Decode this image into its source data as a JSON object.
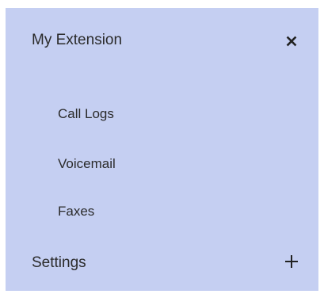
{
  "menu": {
    "sections": [
      {
        "label": "My Extension",
        "toggle_icon": "close-icon",
        "items": [
          "Call Logs",
          "Voicemail",
          "Faxes"
        ]
      },
      {
        "label": "Settings",
        "toggle_icon": "plus-icon",
        "items": []
      }
    ]
  },
  "colors": {
    "panel_background": "#c5cff2",
    "text": "#2b2b2b"
  }
}
